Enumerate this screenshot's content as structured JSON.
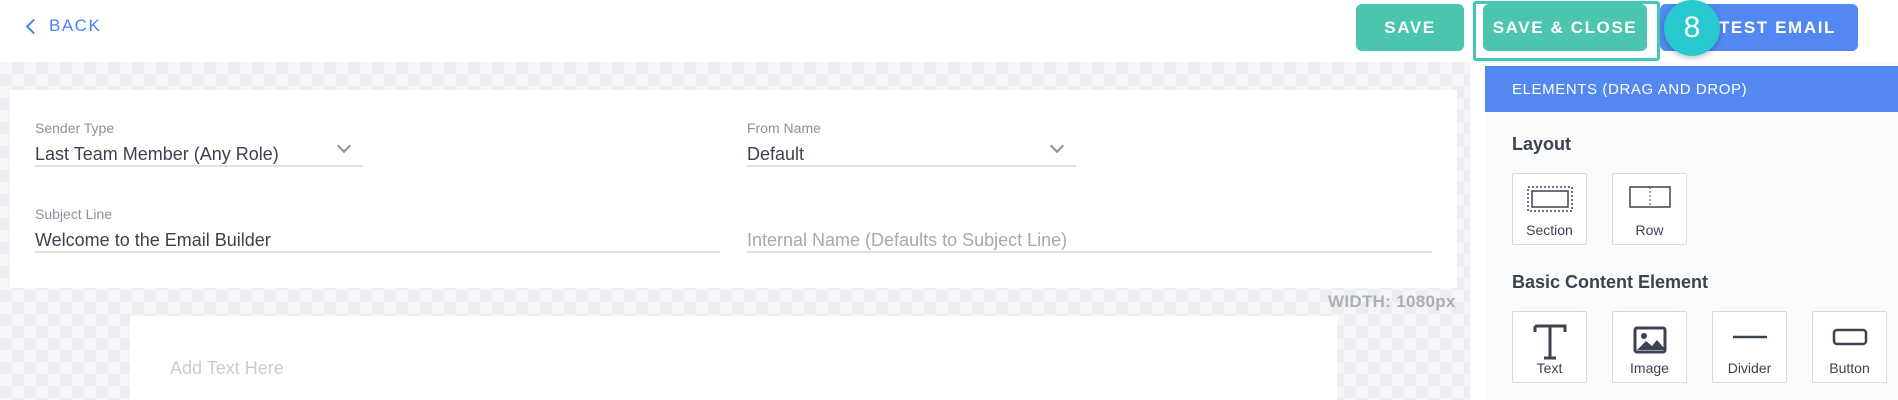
{
  "topbar": {
    "back_label": "BACK",
    "save_label": "SAVE",
    "save_close_label": "SAVE & CLOSE",
    "send_test_label": "ID TEST EMAIL",
    "step_badge": "8"
  },
  "settings": {
    "sender_type": {
      "label": "Sender Type",
      "value": "Last Team Member (Any Role)"
    },
    "from_name": {
      "label": "From Name",
      "value": "Default"
    },
    "subject_line": {
      "label": "Subject Line",
      "value": "Welcome to the Email Builder"
    },
    "internal_name": {
      "placeholder": "Internal Name (Defaults to Subject Line)"
    }
  },
  "canvas": {
    "width_label": "WIDTH: 1080px",
    "body_placeholder": "Add Text Here"
  },
  "panel": {
    "header": "ELEMENTS (DRAG AND DROP)",
    "layout_title": "Layout",
    "layout_items": [
      {
        "label": "Section",
        "icon": "section-icon"
      },
      {
        "label": "Row",
        "icon": "row-icon"
      }
    ],
    "basic_title": "Basic Content Element",
    "basic_items": [
      {
        "label": "Text",
        "icon": "text-icon"
      },
      {
        "label": "Image",
        "icon": "image-icon"
      },
      {
        "label": "Divider",
        "icon": "divider-icon"
      },
      {
        "label": "Button",
        "icon": "button-icon"
      }
    ]
  },
  "colors": {
    "accent_blue": "#5388f2",
    "accent_teal": "#4cc5ae",
    "badge_cyan": "#27c9cf"
  }
}
